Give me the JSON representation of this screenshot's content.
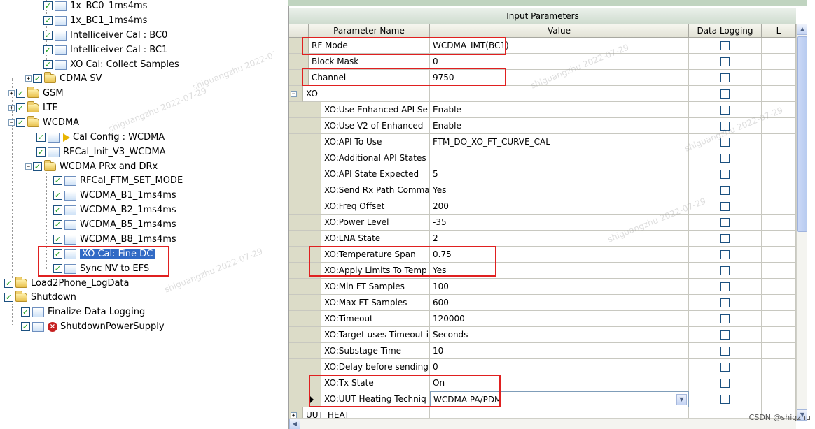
{
  "tree": {
    "items": [
      {
        "label": "1x_BC0_1ms4ms"
      },
      {
        "label": "1x_BC1_1ms4ms"
      },
      {
        "label": "Intelliceiver Cal : BC0"
      },
      {
        "label": "Intelliceiver Cal : BC1"
      },
      {
        "label": "XO Cal: Collect Samples"
      },
      {
        "label": "CDMA SV"
      },
      {
        "label": "GSM"
      },
      {
        "label": "LTE"
      },
      {
        "label": "WCDMA"
      },
      {
        "label": "Cal Config : WCDMA"
      },
      {
        "label": "RFCal_Init_V3_WCDMA"
      },
      {
        "label": "WCDMA PRx and DRx"
      },
      {
        "label": "RFCal_FTM_SET_MODE"
      },
      {
        "label": "WCDMA_B1_1ms4ms"
      },
      {
        "label": "WCDMA_B2_1ms4ms"
      },
      {
        "label": "WCDMA_B5_1ms4ms"
      },
      {
        "label": "WCDMA_B8_1ms4ms"
      },
      {
        "label": "XO Cal: Fine DC"
      },
      {
        "label": "Sync NV to EFS"
      },
      {
        "label": "Load2Phone_LogData"
      },
      {
        "label": "Shutdown"
      },
      {
        "label": "Finalize Data Logging"
      },
      {
        "label": "ShutdownPowerSupply"
      }
    ]
  },
  "grid": {
    "title": "Input Parameters",
    "headers": {
      "name": "Parameter Name",
      "value": "Value",
      "logging": "Data Logging",
      "extra": "L"
    },
    "rows": [
      {
        "name": "RF Mode",
        "value": "WCDMA_IMT(BC1)"
      },
      {
        "name": "Block Mask",
        "value": "0"
      },
      {
        "name": "Channel",
        "value": "9750"
      },
      {
        "name": "XO",
        "value": ""
      },
      {
        "name": "XO:Use Enhanced API Se",
        "value": "Enable"
      },
      {
        "name": "XO:Use V2 of Enhanced",
        "value": "Enable"
      },
      {
        "name": "XO:API To Use",
        "value": "FTM_DO_XO_FT_CURVE_CAL"
      },
      {
        "name": "XO:Additional API States",
        "value": ""
      },
      {
        "name": "XO:API State Expected",
        "value": "5"
      },
      {
        "name": "XO:Send Rx Path Comma",
        "value": "Yes"
      },
      {
        "name": "XO:Freq Offset",
        "value": "200"
      },
      {
        "name": "XO:Power Level",
        "value": "-35"
      },
      {
        "name": "XO:LNA State",
        "value": "2"
      },
      {
        "name": "XO:Temperature Span",
        "value": "0.75"
      },
      {
        "name": "XO:Apply Limits To Temp",
        "value": "Yes"
      },
      {
        "name": "XO:Min FT Samples",
        "value": "100"
      },
      {
        "name": "XO:Max FT Samples",
        "value": "600"
      },
      {
        "name": "XO:Timeout",
        "value": "120000"
      },
      {
        "name": "XO:Target uses Timeout i",
        "value": "Seconds"
      },
      {
        "name": "XO:Substage Time",
        "value": "10"
      },
      {
        "name": "XO:Delay before sending",
        "value": "0"
      },
      {
        "name": "XO:Tx State",
        "value": "On"
      },
      {
        "name": "XO:UUT Heating Techniq",
        "value": "WCDMA PA/PDM"
      },
      {
        "name": "UUT_HEAT",
        "value": ""
      }
    ]
  },
  "watermark": "shiguangzhu 2022-07-29",
  "credit": "CSDN @shigzhu"
}
